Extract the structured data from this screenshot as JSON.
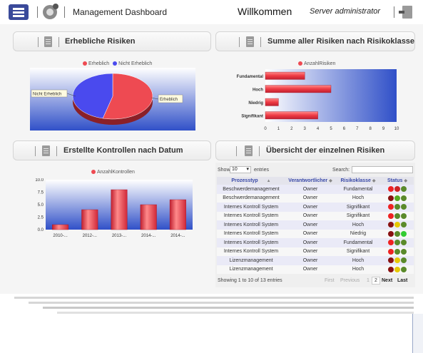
{
  "header": {
    "title": "Management Dashboard",
    "welcome": "Willkommen",
    "user": "Server administrator"
  },
  "panels": {
    "p1_title": "Erhebliche Risiken",
    "p2_title": "Summe aller Risiken nach Risikoklasse",
    "p3_title": "Erstellte Kontrollen nach Datum",
    "p4_title": "Übersicht der einzelnen Risiken"
  },
  "pie": {
    "legend": [
      "Erheblich",
      "Nicht Erheblich"
    ],
    "labels": {
      "left": "Nicht Erheblich",
      "right": "Erheblich"
    }
  },
  "colors": {
    "red": "#ee4a52",
    "blue": "#4a4aee",
    "accent": "#3a4a9a",
    "link": "#3a4aa8"
  },
  "table": {
    "show_label": "Show",
    "entries_label": "entries",
    "page_size": "10",
    "search_label": "Search:",
    "columns": [
      "Prozesstyp",
      "Verantwortlicher",
      "Risikoklasse",
      "Status"
    ],
    "rows": [
      {
        "typ": "Beschwerdemanagement",
        "owner": "Owner",
        "klasse": "Fundamental",
        "status": [
          "#ee2222",
          "#cc2222",
          "#5a8a2a"
        ]
      },
      {
        "typ": "Beschwerdemanagement",
        "owner": "Owner",
        "klasse": "Hoch",
        "status": [
          "#881111",
          "#55aa22",
          "#5a8a2a"
        ]
      },
      {
        "typ": "Internes Kontroll System",
        "owner": "Owner",
        "klasse": "Signifikant",
        "status": [
          "#ee2222",
          "#5a8a2a",
          "#5a8a2a"
        ]
      },
      {
        "typ": "Internes Kontroll System",
        "owner": "Owner",
        "klasse": "Signifikant",
        "status": [
          "#ee2222",
          "#5a8a2a",
          "#5a8a2a"
        ]
      },
      {
        "typ": "Internes Kontroll System",
        "owner": "Owner",
        "klasse": "Hoch",
        "status": [
          "#881111",
          "#e6c800",
          "#5a8a2a"
        ]
      },
      {
        "typ": "Internes Kontroll System",
        "owner": "Owner",
        "klasse": "Niedrig",
        "status": [
          "#881111",
          "#5a8a2a",
          "#33cc33"
        ]
      },
      {
        "typ": "Internes Kontroll System",
        "owner": "Owner",
        "klasse": "Fundamental",
        "status": [
          "#ee2222",
          "#5a8a2a",
          "#5a8a2a"
        ]
      },
      {
        "typ": "Internes Kontroll System",
        "owner": "Owner",
        "klasse": "Signifikant",
        "status": [
          "#ee2222",
          "#5a8a2a",
          "#5a8a2a"
        ]
      },
      {
        "typ": "Lizenzmanagement",
        "owner": "Owner",
        "klasse": "Hoch",
        "status": [
          "#881111",
          "#e6c800",
          "#5a8a2a"
        ]
      },
      {
        "typ": "Lizenzmanagement",
        "owner": "Owner",
        "klasse": "Hoch",
        "status": [
          "#881111",
          "#e6c800",
          "#5a8a2a"
        ]
      }
    ],
    "info": "Showing 1 to 10 of 13 entries",
    "pager": {
      "first": "First",
      "previous": "Previous",
      "p1": "1",
      "p2": "2",
      "next": "Next",
      "last": "Last"
    }
  },
  "chart_data": [
    {
      "type": "pie",
      "categories": [
        "Erheblich",
        "Nicht Erheblich"
      ],
      "values": [
        54,
        46
      ],
      "colors": [
        "#ee4a52",
        "#4a4aee"
      ]
    },
    {
      "type": "bar",
      "orientation": "horizontal",
      "legend": "AnzahlRisiken",
      "categories": [
        "Fundamental",
        "Hoch",
        "Niedrig",
        "Signifikant"
      ],
      "values": [
        3,
        5,
        1,
        4
      ],
      "xticks": [
        "0",
        "1",
        "2",
        "3",
        "4",
        "5",
        "6",
        "7",
        "8",
        "9",
        "10"
      ],
      "xlim": [
        0,
        10
      ]
    },
    {
      "type": "bar",
      "legend": "AnzahlKontrollen",
      "categories": [
        "2010-...",
        "2012-...",
        "2013-...",
        "2014-...",
        "2014-..."
      ],
      "values": [
        1,
        4,
        8,
        5,
        6
      ],
      "yticks": [
        "0.0",
        "2.5",
        "5.0",
        "7.5",
        "10.0"
      ],
      "ylim": [
        0,
        10
      ]
    }
  ]
}
